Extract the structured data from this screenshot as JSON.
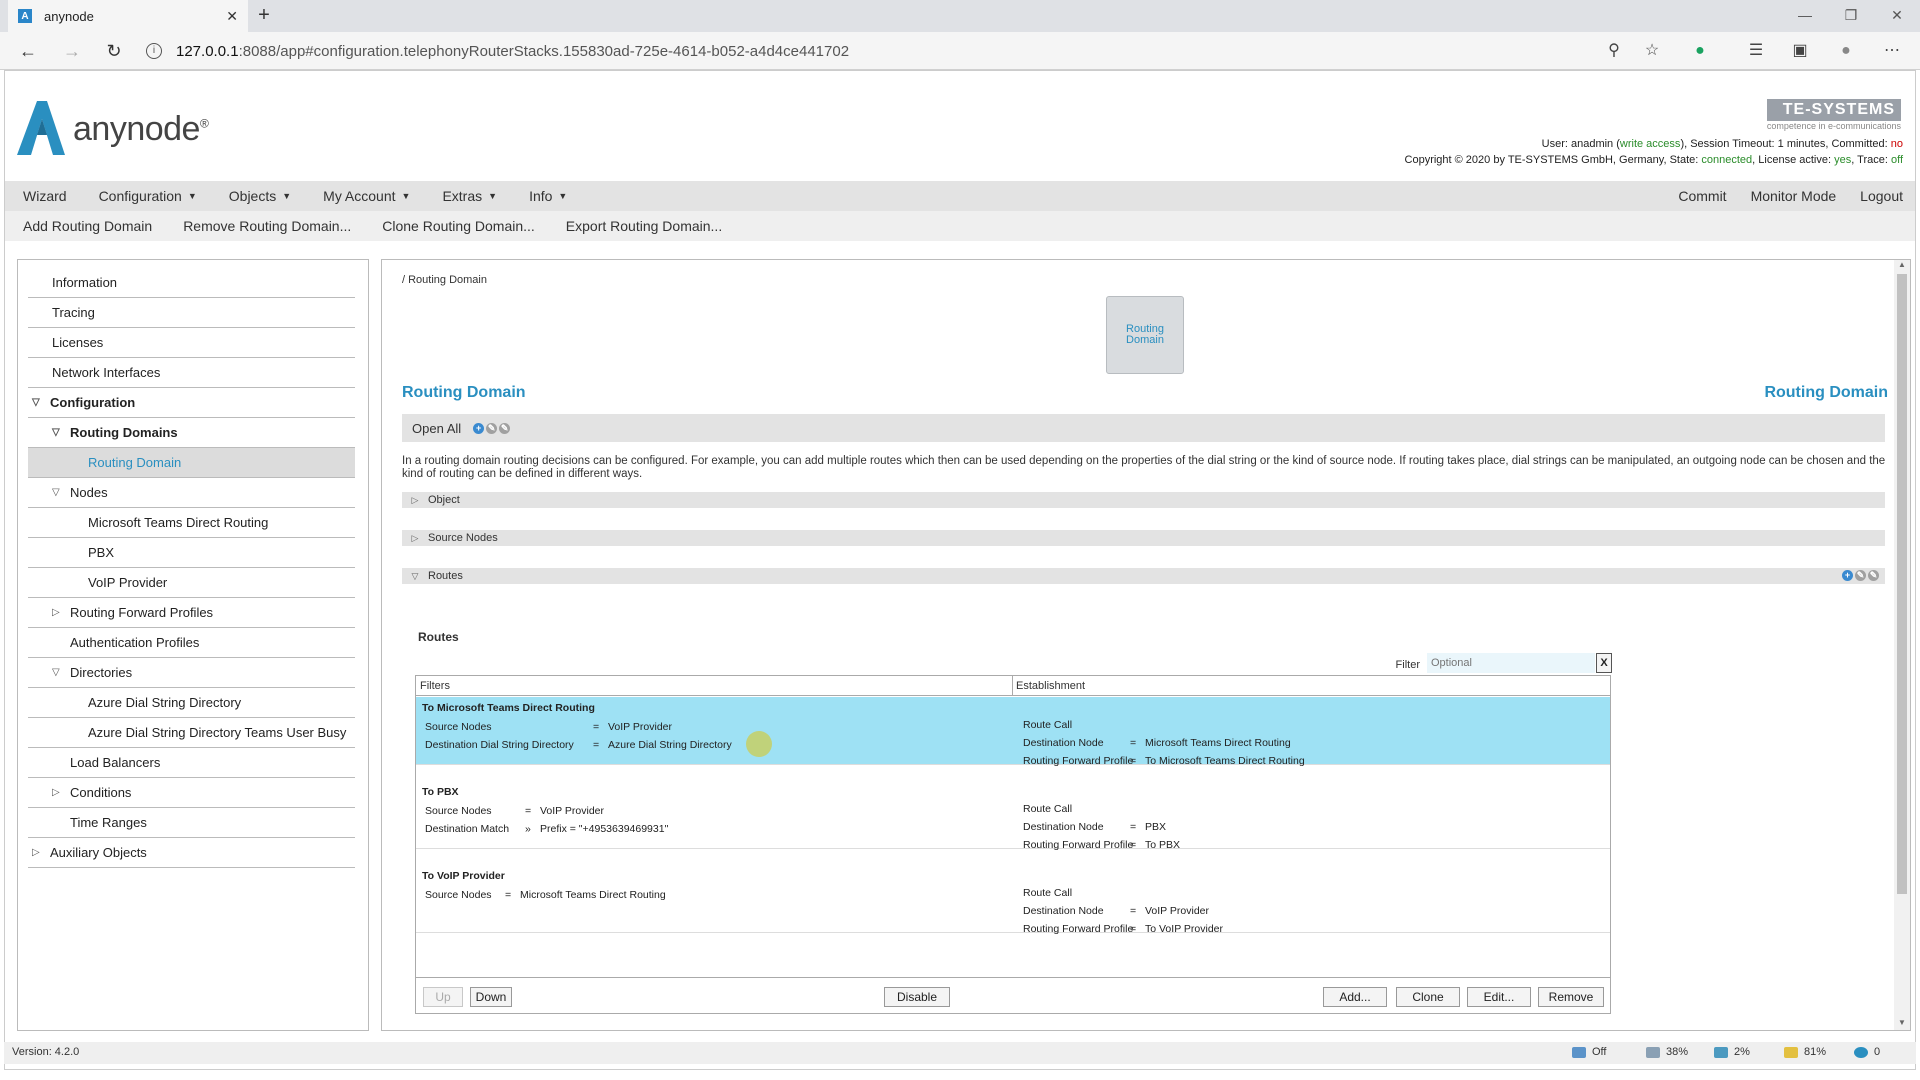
{
  "browser": {
    "tab_title": "anynode",
    "url_host": "127.0.0.1",
    "url_rest": ":8088/app#configuration.telephonyRouterStacks.155830ad-725e-4614-b052-a4d4ce441702"
  },
  "header": {
    "logo_text": "anynode",
    "brand": "TE-SYSTEMS",
    "brand_sub": "competence in e-communications",
    "status_line1_prefix": "User: anadmin (",
    "status_write": "write access",
    "status_line1_suffix": "), Session Timeout: 1 minutes, Committed: ",
    "status_committed": "no",
    "status_line2_prefix": "Copyright © 2020 by TE-SYSTEMS GmbH, Germany, State: ",
    "status_state": "connected",
    "status_line2_mid": ", License active: ",
    "status_license": "yes",
    "status_line2_mid2": ", Trace: ",
    "status_trace": "off"
  },
  "menu": {
    "items": [
      "Wizard",
      "Configuration",
      "Objects",
      "My Account",
      "Extras",
      "Info"
    ],
    "right": [
      "Commit",
      "Monitor Mode",
      "Logout"
    ]
  },
  "submenu": [
    "Add Routing Domain",
    "Remove Routing Domain...",
    "Clone Routing Domain...",
    "Export Routing Domain..."
  ],
  "sidebar": {
    "items": [
      "Information",
      "Tracing",
      "Licenses",
      "Network Interfaces",
      "Configuration",
      "Routing Domains",
      "Routing Domain",
      "Nodes",
      "Microsoft Teams Direct Routing",
      "PBX",
      "VoIP Provider",
      "Routing Forward Profiles",
      "Authentication Profiles",
      "Directories",
      "Azure Dial String Directory",
      "Azure Dial String Directory Teams User Busy",
      "Load Balancers",
      "Conditions",
      "Time Ranges",
      "Auxiliary Objects"
    ]
  },
  "main": {
    "breadcrumb": "/ Routing Domain",
    "node_label": "Routing Domain",
    "title_left": "Routing Domain",
    "title_right": "Routing Domain",
    "open_all": "Open All",
    "description": "In a routing domain routing decisions can be configured. For example, you can add multiple routes which then can be used depending on the properties of the dial string or the kind of source node. If routing takes place, dial strings can be manipulated, an outgoing node can be chosen and the kind of routing can be defined in different ways.",
    "sections": [
      "Object",
      "Source Nodes",
      "Routes"
    ],
    "routes_title": "Routes",
    "filter_label": "Filter",
    "filter_placeholder": "Optional",
    "filter_clear": "X",
    "col_filters": "Filters",
    "col_establishment": "Establishment"
  },
  "routes": [
    {
      "name": "To Microsoft Teams Direct Routing",
      "filters": [
        {
          "key": "Source Nodes",
          "op": "=",
          "val": "VoIP Provider"
        },
        {
          "key": "Destination Dial String Directory",
          "op": "=",
          "val": "Azure Dial String Directory"
        }
      ],
      "action": "Route Call",
      "est": [
        {
          "key": "Destination Node",
          "op": "=",
          "val": "Microsoft Teams Direct Routing"
        },
        {
          "key": "Routing Forward Profile",
          "op": "=",
          "val": "To Microsoft Teams Direct Routing"
        }
      ]
    },
    {
      "name": "To PBX",
      "filters": [
        {
          "key": "Source Nodes",
          "op": "=",
          "val": "VoIP Provider"
        },
        {
          "key": "Destination Match",
          "op": "»",
          "val": "Prefix  =  \"+4953639469931\""
        }
      ],
      "action": "Route Call",
      "est": [
        {
          "key": "Destination Node",
          "op": "=",
          "val": "PBX"
        },
        {
          "key": "Routing Forward Profile",
          "op": "=",
          "val": "To PBX"
        }
      ]
    },
    {
      "name": "To VoIP Provider",
      "filters": [
        {
          "key": "Source Nodes",
          "op": "=",
          "val": "Microsoft Teams Direct Routing"
        }
      ],
      "action": "Route Call",
      "est": [
        {
          "key": "Destination Node",
          "op": "=",
          "val": "VoIP Provider"
        },
        {
          "key": "Routing Forward Profile",
          "op": "=",
          "val": "To VoIP Provider"
        }
      ]
    }
  ],
  "buttons": {
    "up": "Up",
    "down": "Down",
    "disable": "Disable",
    "add": "Add...",
    "clone": "Clone",
    "edit": "Edit...",
    "remove": "Remove"
  },
  "statusbar": {
    "version": "Version: 4.2.0",
    "s1": "Off",
    "s2": "38%",
    "s3": "2%",
    "s4": "81%",
    "s5": "0"
  },
  "colors": {
    "accent": "#2a8fc0",
    "selected_row": "#9ee1f4"
  }
}
